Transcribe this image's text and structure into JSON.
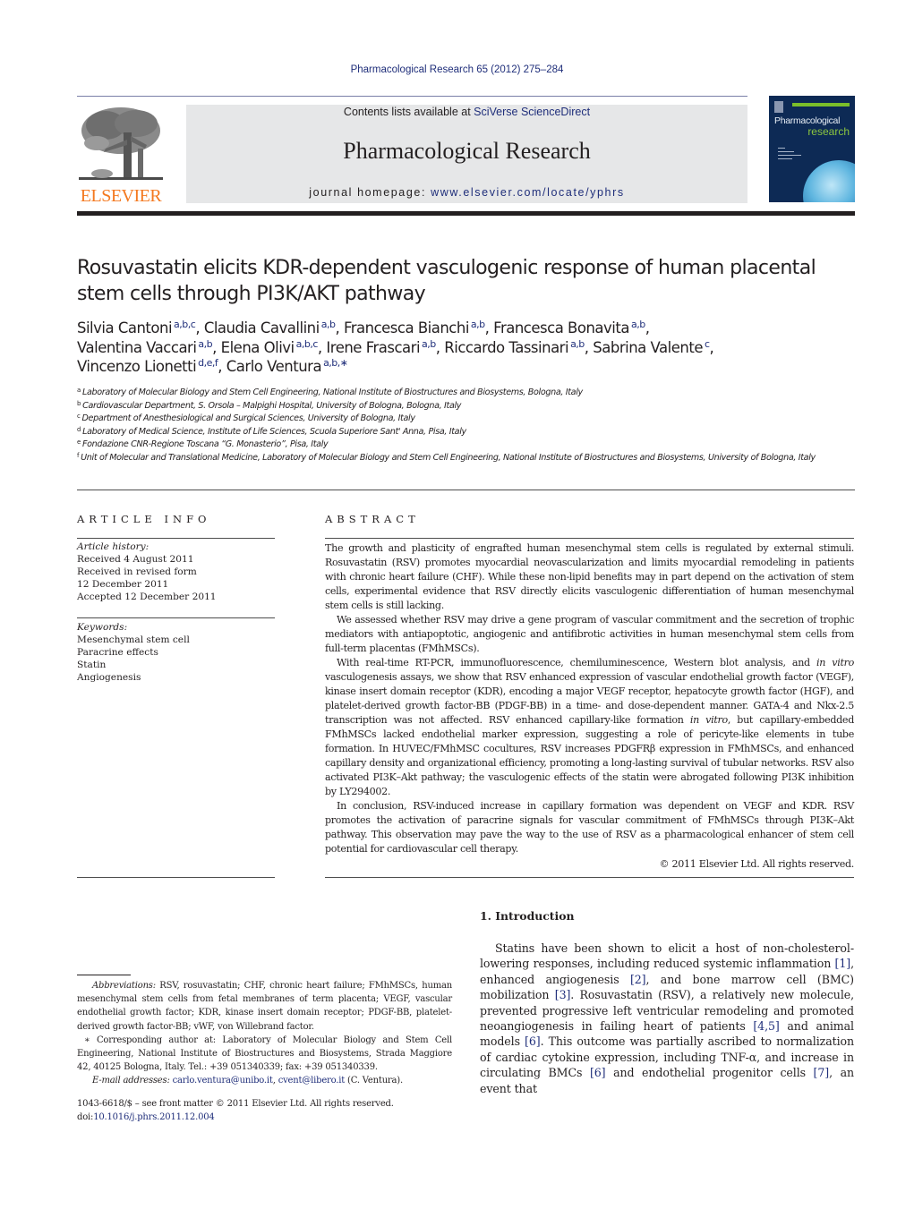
{
  "header": {
    "citation": "Pharmacological Research 65 (2012) 275–284",
    "publisher_logo_text": "ELSEVIER",
    "contents_prefix": "Contents lists available at ",
    "contents_link": "SciVerse ScienceDirect",
    "journal_title": "Pharmacological Research",
    "homepage_prefix": "journal homepage: ",
    "homepage_link": "www.elsevier.com/locate/yphrs",
    "cover": {
      "line1": "Pharmacological",
      "line2": "research"
    }
  },
  "article": {
    "title": "Rosuvastatin elicits KDR-dependent vasculogenic response of human placental stem cells through PI3K/AKT pathway",
    "authors": [
      {
        "name": "Silvia Cantoni",
        "aff": "a,b,c",
        "sep": ", "
      },
      {
        "name": "Claudia Cavallini",
        "aff": "a,b",
        "sep": ", "
      },
      {
        "name": "Francesca Bianchi",
        "aff": "a,b",
        "sep": ", "
      },
      {
        "name": "Francesca Bonavita",
        "aff": "a,b",
        "sep": ","
      },
      {
        "name": "Valentina Vaccari",
        "aff": "a,b",
        "sep": ", "
      },
      {
        "name": "Elena Olivi",
        "aff": "a,b,c",
        "sep": ", "
      },
      {
        "name": "Irene Frascari",
        "aff": "a,b",
        "sep": ", "
      },
      {
        "name": "Riccardo Tassinari",
        "aff": "a,b",
        "sep": ", "
      },
      {
        "name": "Sabrina Valente",
        "aff": "c",
        "sep": ","
      },
      {
        "name": "Vincenzo Lionetti",
        "aff": "d,e,f",
        "sep": ", "
      },
      {
        "name": "Carlo Ventura",
        "aff": "a,b,∗",
        "sep": ""
      }
    ],
    "affiliations": [
      {
        "key": "a",
        "text": "Laboratory of Molecular Biology and Stem Cell Engineering, National Institute of Biostructures and Biosystems, Bologna, Italy"
      },
      {
        "key": "b",
        "text": "Cardiovascular Department, S. Orsola – Malpighi Hospital, University of Bologna, Bologna, Italy"
      },
      {
        "key": "c",
        "text": "Department of Anesthesiological and Surgical Sciences, University of Bologna, Italy"
      },
      {
        "key": "d",
        "text": "Laboratory of Medical Science, Institute of Life Sciences, Scuola Superiore Sant' Anna, Pisa, Italy"
      },
      {
        "key": "e",
        "text": "Fondazione CNR-Regione Toscana “G. Monasterio”, Pisa, Italy"
      },
      {
        "key": "f",
        "text": "Unit of Molecular and Translational Medicine, Laboratory of Molecular Biology and Stem Cell Engineering, National Institute of Biostructures and Biosystems, University of Bologna, Italy"
      }
    ]
  },
  "article_info": {
    "heading": "ARTICLE INFO",
    "history_label": "Article history:",
    "history": [
      "Received 4 August 2011",
      "Received in revised form",
      "12 December 2011",
      "Accepted 12 December 2011"
    ],
    "keywords_label": "Keywords:",
    "keywords": [
      "Mesenchymal stem cell",
      "Paracrine effects",
      "Statin",
      "Angiogenesis"
    ]
  },
  "abstract": {
    "heading": "ABSTRACT",
    "p1": "The growth and plasticity of engrafted human mesenchymal stem cells is regulated by external stimuli. Rosuvastatin (RSV) promotes myocardial neovascularization and limits myocardial remodeling in patients with chronic heart failure (CHF). While these non-lipid benefits may in part depend on the activation of stem cells, experimental evidence that RSV directly elicits vasculogenic differentiation of human mesenchymal stem cells is still lacking.",
    "p2": "We assessed whether RSV may drive a gene program of vascular commitment and the secretion of trophic mediators with antiapoptotic, angiogenic and antifibrotic activities in human mesenchymal stem cells from full-term placentas (FMhMSCs).",
    "p3_a": "With real-time RT-PCR, immunofluorescence, chemiluminescence, Western blot analysis, and ",
    "p3_i1": "in vitro",
    "p3_b": " vasculogenesis assays, we show that RSV enhanced expression of vascular endothelial growth factor (VEGF), kinase insert domain receptor (KDR), encoding a major VEGF receptor, hepatocyte growth factor (HGF), and platelet-derived growth factor-BB (PDGF-BB) in a time- and dose-dependent manner. GATA-4 and Nkx-2.5 transcription was not affected. RSV enhanced capillary-like formation ",
    "p3_i2": "in vitro",
    "p3_c": ", but capillary-embedded FMhMSCs lacked endothelial marker expression, suggesting a role of pericyte-like elements in tube formation. In HUVEC/FMhMSC cocultures, RSV increases PDGFRβ expression in FMhMSCs, and enhanced capillary density and organizational efficiency, promoting a long-lasting survival of tubular networks. RSV also activated PI3K–Akt pathway; the vasculogenic effects of the statin were abrogated following PI3K inhibition by LY294002.",
    "p4": "In conclusion, RSV-induced increase in capillary formation was dependent on VEGF and KDR. RSV promotes the activation of paracrine signals for vascular commitment of FMhMSCs through PI3K–Akt pathway. This observation may pave the way to the use of RSV as a pharmacological enhancer of stem cell potential for cardiovascular cell therapy.",
    "copyright": "© 2011 Elsevier Ltd. All rights reserved."
  },
  "introduction": {
    "heading": "1.  Introduction",
    "segments": [
      {
        "t": "Statins have been shown to elicit a host of non-cholesterol-lowering responses, including reduced systemic inflammation "
      },
      {
        "ref": "[1]"
      },
      {
        "t": ", enhanced angiogenesis "
      },
      {
        "ref": "[2]"
      },
      {
        "t": ", and bone marrow cell (BMC) mobilization "
      },
      {
        "ref": "[3]"
      },
      {
        "t": ". Rosuvastatin (RSV), a relatively new molecule, prevented progressive left ventricular remodeling and promoted neoangiogenesis in failing heart of patients "
      },
      {
        "ref": "[4,5]"
      },
      {
        "t": " and animal models "
      },
      {
        "ref": "[6]"
      },
      {
        "t": ". This outcome was partially ascribed to normalization of cardiac cytokine expression, including TNF-α, and increase in circulating BMCs "
      },
      {
        "ref": "[6]"
      },
      {
        "t": " and endothelial progenitor cells "
      },
      {
        "ref": "[7]"
      },
      {
        "t": ", an event that"
      }
    ]
  },
  "footnotes": {
    "abbrev_label": "Abbreviations:",
    "abbrev_text": " RSV, rosuvastatin; CHF, chronic heart failure; FMhMSCs, human mesenchymal stem cells from fetal membranes of term placenta; VEGF, vascular endothelial growth factor; KDR, kinase insert domain receptor; PDGF-BB, platelet-derived growth factor-BB; vWF, von Willebrand factor.",
    "corresponding": "∗ Corresponding author at: Laboratory of Molecular Biology and Stem Cell Engineering, National Institute of Biostructures and Biosystems, Strada Maggiore 42, 40125 Bologna, Italy. Tel.: +39 051340339; fax: +39 051340339.",
    "email_label": "E-mail addresses:",
    "email1": "carlo.ventura@unibo.it",
    "email_sep": ", ",
    "email2": "cvent@libero.it",
    "email_suffix": " (C. Ventura).",
    "issn": "1043-6618/$ – see front matter © 2011 Elsevier Ltd. All rights reserved.",
    "doi_prefix": "doi:",
    "doi": "10.1016/j.phrs.2011.12.004"
  },
  "colors": {
    "link": "#1f2e7a",
    "elsevier_orange": "#f47920",
    "banner_gray": "#e6e7e8",
    "cover_navy": "#0d2a55",
    "cover_green": "#8cc63f"
  }
}
